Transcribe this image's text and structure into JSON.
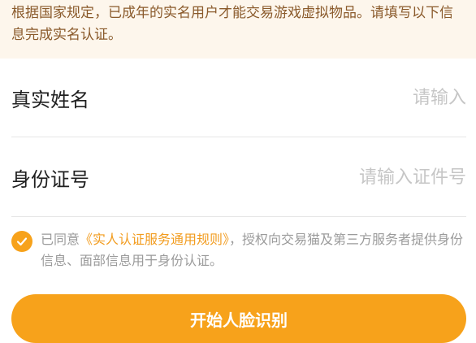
{
  "notice": {
    "text": "根据国家规定，已成年的实名用户才能交易游戏虚拟物品。请填写以下信息完成实名认证。"
  },
  "form": {
    "name_label": "真实姓名",
    "name_placeholder": "请输入",
    "name_value": "",
    "id_label": "身份证号",
    "id_placeholder": "请输入证件号",
    "id_value": ""
  },
  "agreement": {
    "checked": true,
    "prefix": "已同意",
    "link": "《实人认证服务通用规则》",
    "suffix": "，授权向交易猫及第三方服务者提供身份信息、面部信息用于身份认证。"
  },
  "actions": {
    "start_label": "开始人脸识别"
  },
  "colors": {
    "accent": "#f7a21b",
    "notice_bg": "#fdf6ec",
    "notice_text": "#8a5a2b",
    "placeholder": "#c6c6c6"
  },
  "icons": {
    "agreement_check": "checkmark-icon"
  }
}
